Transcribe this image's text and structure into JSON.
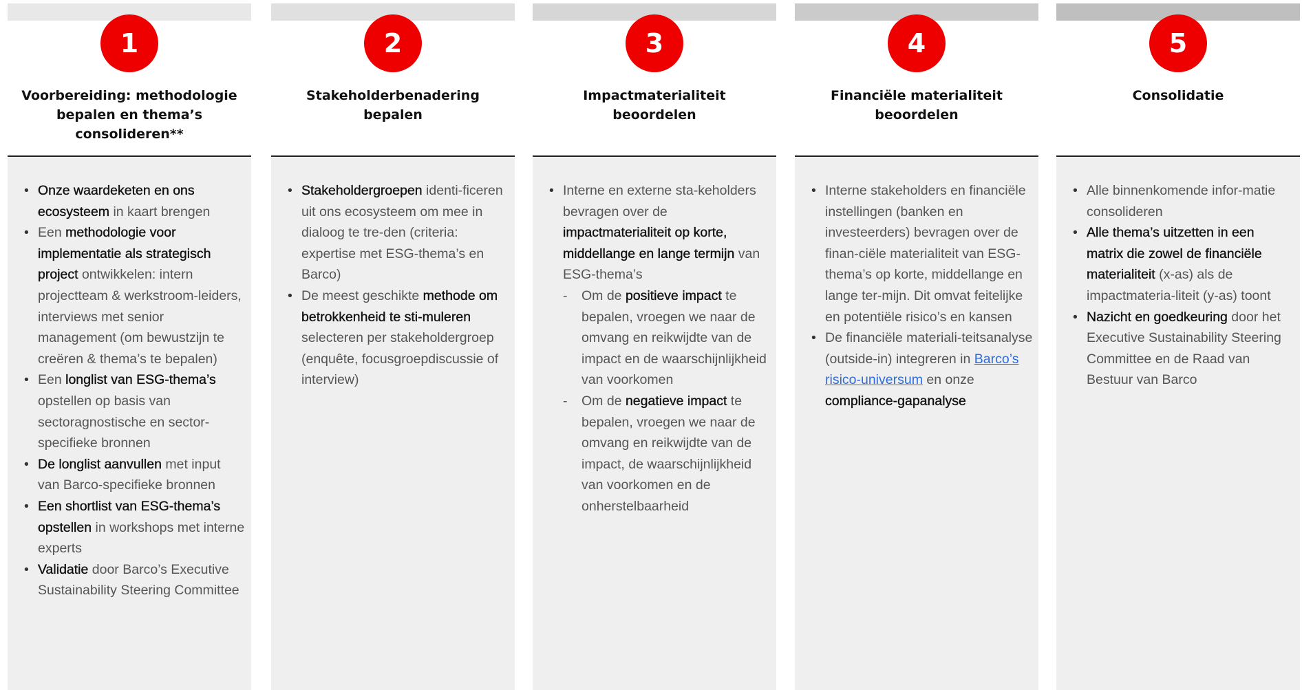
{
  "steps": [
    {
      "number": "1",
      "title_lines": [
        "Voorbereiding: methodologie",
        "bepalen en thema’s",
        "consolideren**"
      ],
      "items": [
        [
          {
            "t": "Onze waardeketen en ons ecosysteem",
            "b": true
          },
          {
            "t": " in kaart brengen",
            "b": false
          }
        ],
        [
          {
            "t": "Een ",
            "b": false
          },
          {
            "t": "methodologie voor implementatie als strategisch project",
            "b": true
          },
          {
            "t": " ontwikkelen: intern projectteam & werkstroom-leiders, interviews met senior management (om bewustzijn te creëren & thema’s te bepalen)",
            "b": false
          }
        ],
        [
          {
            "t": "Een ",
            "b": false
          },
          {
            "t": "longlist van ESG-thema’s",
            "b": true
          },
          {
            "t": " opstellen op basis van sectoragnostische en sector-specifieke bronnen",
            "b": false
          }
        ],
        [
          {
            "t": "De longlist aanvullen",
            "b": true
          },
          {
            "t": " met input van Barco-specifieke bronnen",
            "b": false
          }
        ],
        [
          {
            "t": "Een shortlist van ESG-thema’s opstellen",
            "b": true
          },
          {
            "t": " in workshops met interne experts",
            "b": false
          }
        ],
        [
          {
            "t": "Validatie",
            "b": true
          },
          {
            "t": " door Barco’s Executive Sustainability Steering Committee",
            "b": false
          }
        ]
      ]
    },
    {
      "number": "2",
      "title_lines": [
        "Stakeholderbenadering",
        "bepalen"
      ],
      "items": [
        [
          {
            "t": "Stakeholdergroepen",
            "b": true
          },
          {
            "t": " identi-ficeren uit ons ecosysteem om mee in dialoog te tre-den (criteria: expertise met ESG-thema’s en Barco)",
            "b": false
          }
        ],
        [
          {
            "t": "De meest geschikte ",
            "b": false
          },
          {
            "t": "methode om betrokkenheid te sti-muleren",
            "b": true
          },
          {
            "t": " selecteren per stakeholdergroep (enquête, focusgroepdiscussie of interview)",
            "b": false
          }
        ]
      ]
    },
    {
      "number": "3",
      "title_lines": [
        "Impactmaterialiteit",
        "beoordelen"
      ],
      "items": [
        [
          {
            "t": "Interne en externe sta-keholders bevragen over de ",
            "b": false
          },
          {
            "t": "impactmaterialiteit op korte, middellange en lange termijn",
            "b": true
          },
          {
            "t": " van ESG-thema’s",
            "b": false
          }
        ]
      ],
      "subitems": [
        [
          {
            "t": "Om de ",
            "b": false
          },
          {
            "t": "positieve impact",
            "b": true
          },
          {
            "t": " te bepalen, vroegen we naar de omvang en reikwijdte van de impact en de waarschijnlijkheid van voorkomen",
            "b": false
          }
        ],
        [
          {
            "t": "Om de ",
            "b": false
          },
          {
            "t": "negatieve impact",
            "b": true
          },
          {
            "t": " te bepalen, vroegen we naar de omvang en reikwijdte van de impact, de waarschijnlijkheid van voorkomen en de onherstelbaarheid",
            "b": false
          }
        ]
      ]
    },
    {
      "number": "4",
      "title_lines": [
        "Financiële materialiteit",
        "beoordelen"
      ],
      "items": [
        [
          {
            "t": "Interne stakeholders en financiële instellingen (banken en investeerders) bevragen over de finan-ciële materialiteit van ESG-thema’s op korte, middellange en lange ter-mijn. Dit omvat feitelijke en potentiële risico’s en kansen",
            "b": false
          }
        ],
        [
          {
            "t": "De financiële materiali-teitsanalyse (outside-in) integreren in ",
            "b": false
          },
          {
            "t": "Barco’s risico-universum",
            "b": false,
            "link": true
          },
          {
            "t": " en onze ",
            "b": false
          },
          {
            "t": "compliance-gapanalyse",
            "b": true
          }
        ]
      ]
    },
    {
      "number": "5",
      "title_lines": [
        "Consolidatie"
      ],
      "items": [
        [
          {
            "t": "Alle binnenkomende infor-matie consolideren",
            "b": false
          }
        ],
        [
          {
            "t": "Alle thema’s uitzetten in een matrix die zowel de financiële materialiteit",
            "b": true
          },
          {
            "t": " (x-as) als de impactmateria-liteit (y-as) toont",
            "b": false
          }
        ],
        [
          {
            "t": "Nazicht en goedkeuring",
            "b": true
          },
          {
            "t": " door het Executive Sustainability Steering Committee en de Raad van Bestuur van Barco",
            "b": false
          }
        ]
      ]
    }
  ]
}
